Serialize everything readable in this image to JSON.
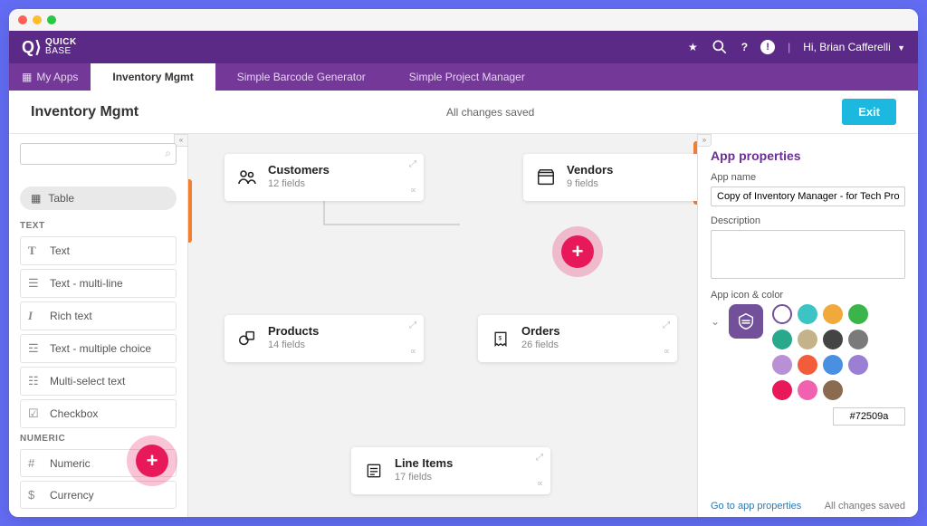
{
  "header": {
    "brand_top": "QUICK",
    "brand_bottom": "BASE",
    "greeting": "Hi, Brian Cafferelli"
  },
  "tabs": {
    "my_apps": "My Apps",
    "items": [
      {
        "label": "Inventory Mgmt",
        "active": true
      },
      {
        "label": "Simple Barcode Generator",
        "active": false
      },
      {
        "label": "Simple Project Manager",
        "active": false
      }
    ]
  },
  "toolbar": {
    "title": "Inventory Mgmt",
    "status": "All changes saved",
    "exit": "Exit"
  },
  "left": {
    "table_pill": "Table",
    "sections": {
      "text_hdr": "TEXT",
      "numeric_hdr": "NUMERIC"
    },
    "text_fields": [
      {
        "icon": "T",
        "label": "Text"
      },
      {
        "icon": "multiline",
        "label": "Text - multi-line"
      },
      {
        "icon": "I",
        "label": "Rich text"
      },
      {
        "icon": "list",
        "label": "Text - multiple choice"
      },
      {
        "icon": "multiselect",
        "label": "Multi-select text"
      },
      {
        "icon": "check",
        "label": "Checkbox"
      }
    ],
    "numeric_fields": [
      {
        "icon": "#",
        "label": "Numeric"
      },
      {
        "icon": "$",
        "label": "Currency"
      }
    ]
  },
  "nodes": {
    "customers": {
      "title": "Customers",
      "sub": "12 fields"
    },
    "vendors": {
      "title": "Vendors",
      "sub": "9 fields"
    },
    "products": {
      "title": "Products",
      "sub": "14 fields"
    },
    "orders": {
      "title": "Orders",
      "sub": "26 fields"
    },
    "lineitems": {
      "title": "Line Items",
      "sub": "17 fields"
    }
  },
  "right": {
    "title": "App properties",
    "name_label": "App name",
    "name_value": "Copy of Inventory Manager - for Tech Prob Solver Screenshots",
    "desc_label": "Description",
    "desc_value": "",
    "icon_label": "App icon & color",
    "hex": "#72509a",
    "footer_link": "Go to app properties",
    "footer_saved": "All changes saved",
    "swatches": [
      "hollow",
      "#3cc4c4",
      "#f2a93b",
      "#3ab54a",
      "#28a98c",
      "#c4b38a",
      "#444444",
      "#7a7a7a",
      "#b98fd6",
      "#f25c3b",
      "#4a90e2",
      "#9b7fd4",
      "#e8195b",
      "#f062b0",
      "#8a6b4f"
    ]
  }
}
